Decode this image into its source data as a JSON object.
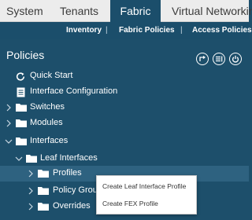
{
  "topnav": {
    "tabs": [
      {
        "label": "System",
        "active": false
      },
      {
        "label": "Tenants",
        "active": false
      },
      {
        "label": "Fabric",
        "active": true
      },
      {
        "label": "Virtual Networking",
        "active": false
      }
    ]
  },
  "subnav": {
    "items": [
      {
        "label": "Inventory",
        "active": false
      },
      {
        "label": "Fabric Policies",
        "active": false
      },
      {
        "label": "Access Policies",
        "active": true
      }
    ],
    "separator": "|"
  },
  "panel": {
    "title": "Policies",
    "toolbar": [
      "recycle-icon",
      "list-icon",
      "power-icon"
    ]
  },
  "tree": [
    {
      "label": "Quick Start",
      "icon": "quickstart-icon",
      "expandable": false
    },
    {
      "label": "Interface Configuration",
      "icon": "document-icon",
      "expandable": false
    },
    {
      "label": "Switches",
      "icon": "folder-icon",
      "expandable": true,
      "expanded": false
    },
    {
      "label": "Modules",
      "icon": "folder-icon",
      "expandable": true,
      "expanded": false
    },
    {
      "label": "Interfaces",
      "icon": "folder-icon",
      "expandable": true,
      "expanded": true
    },
    {
      "label": "Leaf Interfaces",
      "icon": "folder-icon",
      "expandable": true,
      "expanded": true
    },
    {
      "label": "Profiles",
      "icon": "folder-icon",
      "expandable": true,
      "expanded": false,
      "selected": true
    },
    {
      "label": "Policy Groups",
      "icon": "folder-icon",
      "expandable": true,
      "expanded": false
    },
    {
      "label": "Overrides",
      "icon": "folder-icon",
      "expandable": true,
      "expanded": false
    }
  ],
  "context_menu": {
    "items": [
      "Create Leaf Interface Profile",
      "Create FEX Profile"
    ]
  },
  "colors": {
    "panel_bg": "#1d4f6b",
    "selected_row": "#2e6280",
    "topnav_bg": "#ececec",
    "active_tab": "#1b4e6b"
  }
}
